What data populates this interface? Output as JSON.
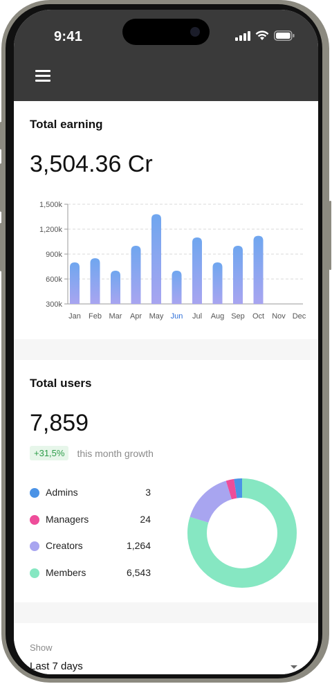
{
  "status_bar": {
    "time": "9:41"
  },
  "header": {
    "menu_icon": "hamburger-menu-icon",
    "background": "#3a3a3a"
  },
  "earning": {
    "title": "Total earning",
    "value": "3,504.36 Cr"
  },
  "chart_data": {
    "type": "bar",
    "categories": [
      "Jan",
      "Feb",
      "Mar",
      "Apr",
      "May",
      "Jun",
      "Jul",
      "Aug",
      "Sep",
      "Oct",
      "Nov",
      "Dec"
    ],
    "values": [
      800,
      850,
      700,
      1000,
      1380,
      700,
      1100,
      800,
      1000,
      1120
    ],
    "y_ticks": [
      "1,500k",
      "1,200k",
      "900k",
      "600k",
      "300k"
    ],
    "ylim": [
      300,
      1500
    ],
    "highlighted_category": "Jun",
    "grid": true,
    "colors": {
      "bar_top": "#6fa6ef",
      "bar_bottom": "#a8a5f0",
      "highlight_label": "#2f6fd8"
    }
  },
  "users": {
    "title": "Total users",
    "value": "7,859",
    "growth_badge": "+31,5%",
    "growth_text": "this month growth",
    "legend": [
      {
        "label": "Admins",
        "count": "3",
        "value": 3,
        "color": "#4b93e6"
      },
      {
        "label": "Managers",
        "count": "24",
        "value": 24,
        "color": "#ee4d9a"
      },
      {
        "label": "Creators",
        "count": "1,264",
        "value": 1264,
        "color": "#a8a5f0"
      },
      {
        "label": "Members",
        "count": "6,543",
        "value": 6543,
        "color": "#86e7c2"
      }
    ]
  },
  "filter": {
    "label": "Show",
    "value": "Last 7 days"
  }
}
